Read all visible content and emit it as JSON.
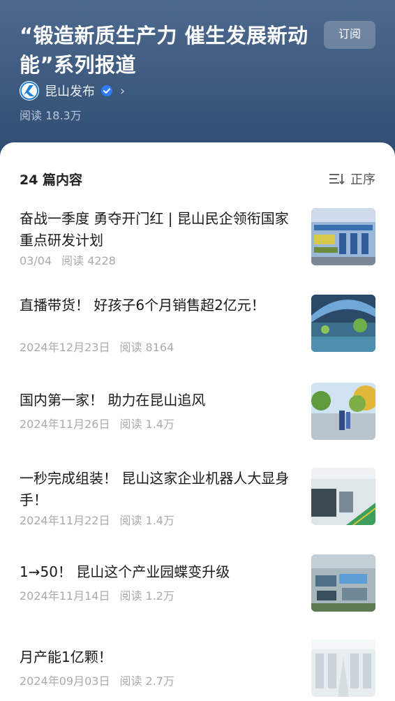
{
  "header": {
    "title": "“锻造新质生产力 催生发展新动能”系列报道",
    "subscribe_label": "订阅",
    "author_name": "昆山发布",
    "reads": "阅读 18.3万"
  },
  "list": {
    "count_label": "24 篇内容",
    "order_label": "正序",
    "items": [
      {
        "title": "奋战一季度 勇夺开门红 | 昆山民企领衔国家重点研发计划",
        "date": "03/04",
        "reads": "阅读 4228"
      },
      {
        "title": "直播带货！ 好孩子6个月销售超2亿元！",
        "date": "2024年12月23日",
        "reads": "阅读 8164"
      },
      {
        "title": "国内第一家！ 助力在昆山追风",
        "date": "2024年11月26日",
        "reads": "阅读 1.4万"
      },
      {
        "title": "一秒完成组装！ 昆山这家企业机器人大显身手！",
        "date": "2024年11月22日",
        "reads": "阅读 1.4万"
      },
      {
        "title": "1→50！ 昆山这个产业园蝶变升级",
        "date": "2024年11月14日",
        "reads": "阅读 1.2万"
      },
      {
        "title": "月产能1亿颗！",
        "date": "2024年09月03日",
        "reads": "阅读 2.7万"
      }
    ]
  },
  "icons": {
    "verified": "verified-badge-icon",
    "chevron": "chevron-right-icon",
    "order": "sort-order-icon"
  },
  "colors": {
    "header_bg": "#3f5c80",
    "verified_blue": "#2f7cf6",
    "meta_gray": "#aaaaaa"
  }
}
